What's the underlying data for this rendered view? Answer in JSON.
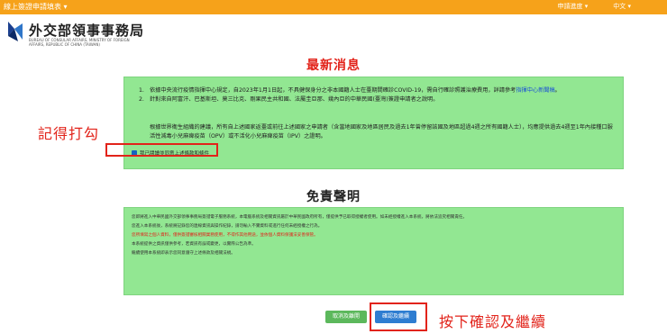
{
  "topbar": {
    "service": "線上簽證申請填表 ▾",
    "lang_menu": "申請進度 ▾",
    "lang": "中文 ▾"
  },
  "logo": {
    "name": "外交部領事事務局",
    "en1": "BUREAU OF CONSULAR AFFAIRS, MINISTRY OF FOREIGN",
    "en2": "AFFAIRS, REPUBLIC OF CHINA (TAIWAN)"
  },
  "news": {
    "title": "最新消息",
    "items": [
      {
        "num": "1.",
        "text": "依據中央流行疫情指揮中心規定，自2023年1月1日起，不具健保身分之非本國籍人士在臺期間確診COVID-19，需自行確診照護治療費用，詳請參考",
        "link": "指揮中心新聞稿",
        "after": "。"
      },
      {
        "num": "2.",
        "text": "針對來自阿富汗、巴基斯坦、莫三比克、剛果民主共和國、法屬圭亞那、幾內亞的中華民國(臺灣)簽證申請者之說明。",
        "link": "",
        "after": ""
      }
    ],
    "paragraph": "根據世界衛生組織的建議，所有自上述國家返臺或前往上述國家之申請者（含當地國家及地區居民及過去1年曾停留該國及地區超過4週之所有國籍人士），均應提供過去4週至1年內接種口服活性減毒小兒麻痺疫苗（OPV）或不活化小兒麻痺疫苗（IPV）之證明。",
    "agree_label": "我已閱讀並同意上述條款和條件",
    "annotation": "記得打勾"
  },
  "disclaimer": {
    "title": "免責聲明",
    "paragraphs": [
      "您即將進入中華民國外交部領事事務局簽證電子服務系統，本電腦系統及相關資訊屬於中華民國政府所有，僅提供予已取得授權者使用。如未經授權進入本系統，將依法追究相關責任。",
      "您進入本系統後，系統將記錄您的連線資訊與操作紀錄，請勿輸入不實資料或進行任何未經授權之行為。",
      "您所填寫之個人資料，僅供簽證審核相關業務使用，不得作其他用途，並依個人資料保護法妥善保管。",
      "本系統提供之資訊僅供參考，若資訊有誤或變更，以實際公告為準。",
      "繼續使用本系統即表示您同意遵守上述條款及相關法規。"
    ],
    "cancel_label": "取消及離開",
    "confirm_label": "確認及繼續",
    "annotation": "按下確認及繼續"
  },
  "colors": {
    "accent": "#f6a21a",
    "panel": "#92e792",
    "alert": "#e2231a",
    "confirm": "#2e7dd1",
    "cancel": "#5cb85c"
  }
}
